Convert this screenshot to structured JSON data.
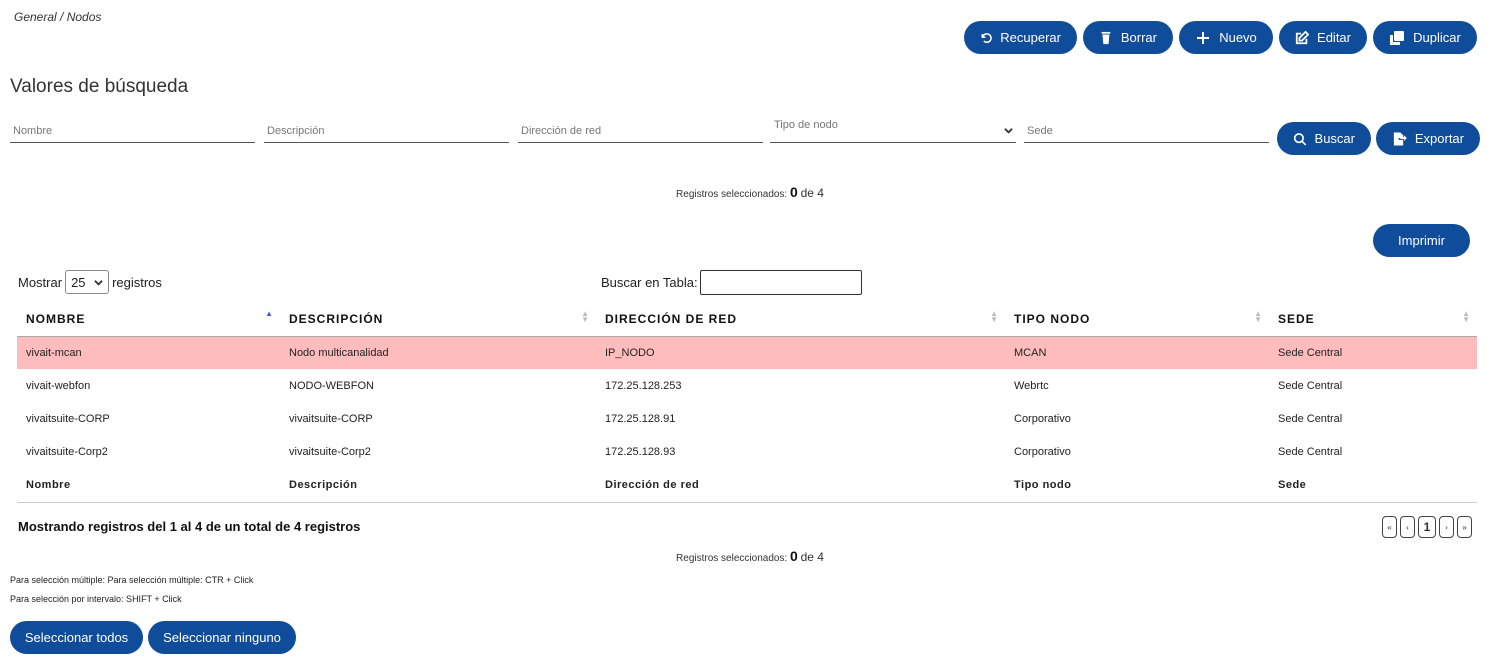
{
  "breadcrumb": "General / Nodos",
  "toolbar": {
    "recuperar": "Recuperar",
    "borrar": "Borrar",
    "nuevo": "Nuevo",
    "editar": "Editar",
    "duplicar": "Duplicar"
  },
  "search": {
    "title": "Valores de búsqueda",
    "nombre_placeholder": "Nombre",
    "descripcion_placeholder": "Descripción",
    "direccion_placeholder": "Dirección de red",
    "tipo_placeholder": "Tipo de nodo",
    "sede_placeholder": "Sede",
    "buscar": "Buscar",
    "exportar": "Exportar"
  },
  "selection_top": {
    "label": "Registros seleccionados:",
    "count": "0",
    "of": "de 4"
  },
  "imprimir": "Imprimir",
  "length_menu": {
    "prefix": "Mostrar",
    "value": "25",
    "suffix": "registros"
  },
  "table_search": {
    "label": "Buscar en Tabla:",
    "value": ""
  },
  "table": {
    "headers": [
      "NOMBRE",
      "DESCRIPCIÓN",
      "DIRECCIÓN DE RED",
      "TIPO NODO",
      "SEDE"
    ],
    "rows": [
      [
        "vivait-mcan",
        "Nodo multicanalidad",
        "IP_NODO",
        "MCAN",
        "Sede Central"
      ],
      [
        "vivait-webfon",
        "NODO-WEBFON",
        "172.25.128.253",
        "Webrtc",
        "Sede Central"
      ],
      [
        "vivaitsuite-CORP",
        "vivaitsuite-CORP",
        "172.25.128.91",
        "Corporativo",
        "Sede Central"
      ],
      [
        "vivaitsuite-Corp2",
        "vivaitsuite-Corp2",
        "172.25.128.93",
        "Corporativo",
        "Sede Central"
      ]
    ],
    "footers": [
      "Nombre",
      "Descripción",
      "Dirección de red",
      "Tipo nodo",
      "Sede"
    ]
  },
  "info": "Mostrando registros del 1 al 4 de un total de 4 registros",
  "pagination": {
    "first": "«",
    "prev": "‹",
    "current": "1",
    "next": "›",
    "last": "»"
  },
  "selection_bottom": {
    "label": "Registros seleccionados:",
    "count": "0",
    "of": "de 4"
  },
  "hints": {
    "multiple": "Para selección múltiple: Para selección múltiple: CTR + Click",
    "interval": "Para selección por intervalo: SHIFT + Click"
  },
  "bottom_buttons": {
    "all": "Seleccionar todos",
    "none": "Seleccionar ninguno"
  },
  "colors": {
    "primary": "#0f4c9a",
    "selected_row": "#ffbcbc",
    "sort_active": "#4a57d6"
  }
}
